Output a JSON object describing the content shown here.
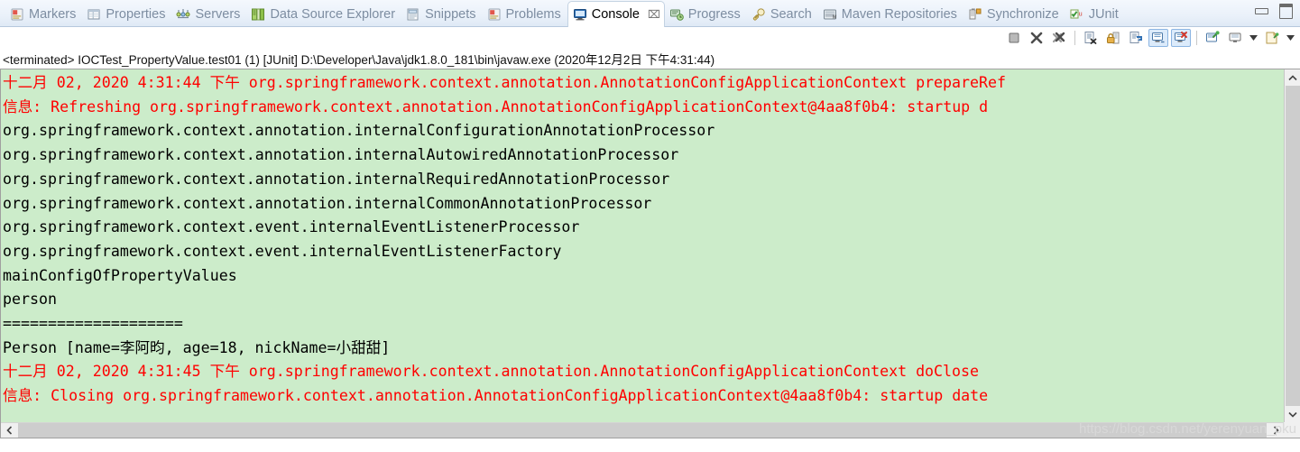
{
  "window": {
    "minimize_label": "Minimize",
    "maximize_label": "Maximize"
  },
  "tabs": [
    {
      "label": "Markers",
      "icon": "markers-icon",
      "active": false
    },
    {
      "label": "Properties",
      "icon": "properties-icon",
      "active": false
    },
    {
      "label": "Servers",
      "icon": "servers-icon",
      "active": false
    },
    {
      "label": "Data Source Explorer",
      "icon": "data-source-explorer-icon",
      "active": false
    },
    {
      "label": "Snippets",
      "icon": "snippets-icon",
      "active": false
    },
    {
      "label": "Problems",
      "icon": "problems-icon",
      "active": false
    },
    {
      "label": "Console",
      "icon": "console-icon",
      "active": true,
      "close_glyph": "⌧"
    },
    {
      "label": "Progress",
      "icon": "progress-icon",
      "active": false
    },
    {
      "label": "Search",
      "icon": "search-icon",
      "active": false
    },
    {
      "label": "Maven Repositories",
      "icon": "maven-repositories-icon",
      "active": false
    },
    {
      "label": "Synchronize",
      "icon": "synchronize-icon",
      "active": false
    },
    {
      "label": "JUnit",
      "icon": "junit-icon",
      "active": false
    }
  ],
  "toolbar": {
    "buttons": [
      {
        "name": "terminate-button",
        "label": "Terminate",
        "toggled": false
      },
      {
        "name": "remove-launch-button",
        "label": "Remove Launch",
        "toggled": false
      },
      {
        "name": "remove-all-terminated-button",
        "label": "Remove All Terminated Launches",
        "toggled": false
      },
      {
        "name": "clear-console-button",
        "label": "Clear Console",
        "toggled": false
      },
      {
        "name": "scroll-lock-button",
        "label": "Scroll Lock",
        "toggled": false
      },
      {
        "name": "word-wrap-button",
        "label": "Word Wrap",
        "toggled": false
      },
      {
        "name": "show-console-on-output-button",
        "label": "Show Console When Standard Out Changes",
        "toggled": true
      },
      {
        "name": "show-console-on-error-button",
        "label": "Show Console When Standard Error Changes",
        "toggled": true
      },
      {
        "name": "pin-console-button",
        "label": "Pin Console",
        "toggled": false
      },
      {
        "name": "display-selected-console-button",
        "label": "Display Selected Console",
        "toggled": false
      },
      {
        "name": "new-console-view-button",
        "label": "Open Console",
        "toggled": false
      }
    ]
  },
  "launch": {
    "description": "<terminated> IOCTest_PropertyValue.test01 (1) [JUnit] D:\\Developer\\Java\\jdk1.8.0_181\\bin\\javaw.exe (2020年12月2日 下午4:31:44)"
  },
  "console": {
    "background_color": "#ccecca",
    "error_color": "#ff0000",
    "text_color": "#000000",
    "lines": [
      {
        "style": "err",
        "text": "十二月 02, 2020 4:31:44 下午 org.springframework.context.annotation.AnnotationConfigApplicationContext prepareRef"
      },
      {
        "style": "err",
        "text": "信息: Refreshing org.springframework.context.annotation.AnnotationConfigApplicationContext@4aa8f0b4: startup d"
      },
      {
        "style": "normal",
        "text": "org.springframework.context.annotation.internalConfigurationAnnotationProcessor"
      },
      {
        "style": "normal",
        "text": "org.springframework.context.annotation.internalAutowiredAnnotationProcessor"
      },
      {
        "style": "normal",
        "text": "org.springframework.context.annotation.internalRequiredAnnotationProcessor"
      },
      {
        "style": "normal",
        "text": "org.springframework.context.annotation.internalCommonAnnotationProcessor"
      },
      {
        "style": "normal",
        "text": "org.springframework.context.event.internalEventListenerProcessor"
      },
      {
        "style": "normal",
        "text": "org.springframework.context.event.internalEventListenerFactory"
      },
      {
        "style": "normal",
        "text": "mainConfigOfPropertyValues"
      },
      {
        "style": "normal",
        "text": "person"
      },
      {
        "style": "normal",
        "text": "===================="
      },
      {
        "style": "normal",
        "text": "Person [name=李阿昀, age=18, nickName=小甜甜]"
      },
      {
        "style": "err",
        "text": "十二月 02, 2020 4:31:45 下午 org.springframework.context.annotation.AnnotationConfigApplicationContext doClose"
      },
      {
        "style": "err",
        "text": "信息: Closing org.springframework.context.annotation.AnnotationConfigApplicationContext@4aa8f0b4: startup date"
      }
    ]
  },
  "scrollbars": {
    "vertical": {
      "up_glyph": "˄",
      "down_glyph": "˅"
    },
    "horizontal": {
      "left_glyph": "‹",
      "right_glyph": "›"
    }
  },
  "watermark": {
    "text": "https://blog.csdn.net/yerenyuan_pku"
  }
}
